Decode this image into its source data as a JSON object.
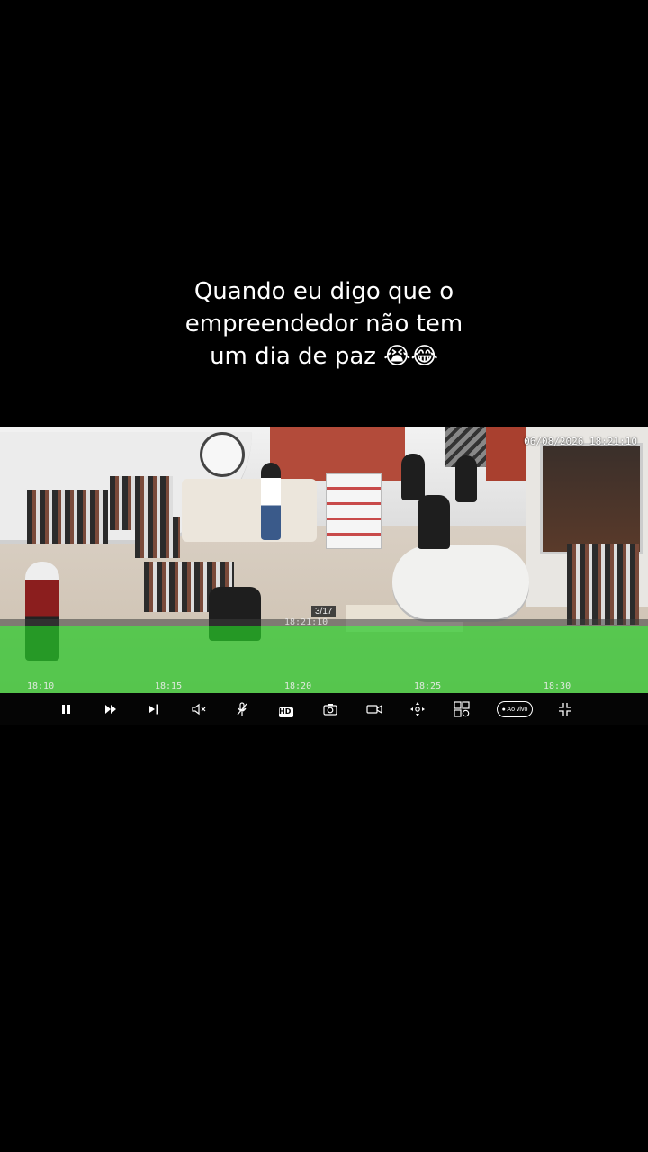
{
  "caption": {
    "line1": "Quando eu digo que o",
    "line2": "empreendedor não tem",
    "line3": "um dia de paz 😭😂"
  },
  "camera": {
    "timestamp": "06/08/2026 18:21:10",
    "clip_counter": "3/17",
    "cursor_time": "18:21:10"
  },
  "timeline": {
    "ticks": [
      "18:10",
      "18:15",
      "18:20",
      "18:25",
      "18:30"
    ]
  },
  "controls": {
    "hd_label": "HD",
    "live_label": "● Ao vivo"
  },
  "colors": {
    "timeline": "#28c828",
    "background": "#000000"
  }
}
